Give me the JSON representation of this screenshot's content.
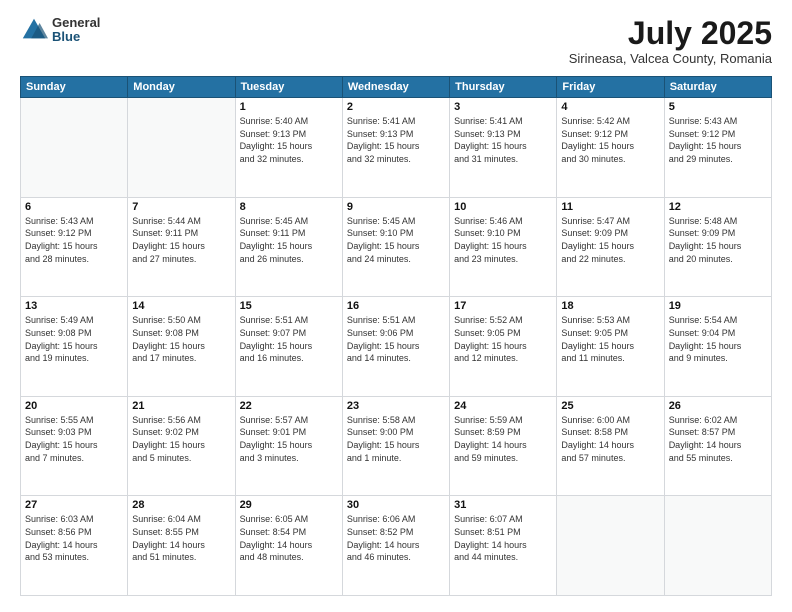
{
  "logo": {
    "general": "General",
    "blue": "Blue"
  },
  "title": "July 2025",
  "location": "Sirineasa, Valcea County, Romania",
  "days_of_week": [
    "Sunday",
    "Monday",
    "Tuesday",
    "Wednesday",
    "Thursday",
    "Friday",
    "Saturday"
  ],
  "weeks": [
    [
      {
        "day": "",
        "info": ""
      },
      {
        "day": "",
        "info": ""
      },
      {
        "day": "1",
        "info": "Sunrise: 5:40 AM\nSunset: 9:13 PM\nDaylight: 15 hours\nand 32 minutes."
      },
      {
        "day": "2",
        "info": "Sunrise: 5:41 AM\nSunset: 9:13 PM\nDaylight: 15 hours\nand 32 minutes."
      },
      {
        "day": "3",
        "info": "Sunrise: 5:41 AM\nSunset: 9:13 PM\nDaylight: 15 hours\nand 31 minutes."
      },
      {
        "day": "4",
        "info": "Sunrise: 5:42 AM\nSunset: 9:12 PM\nDaylight: 15 hours\nand 30 minutes."
      },
      {
        "day": "5",
        "info": "Sunrise: 5:43 AM\nSunset: 9:12 PM\nDaylight: 15 hours\nand 29 minutes."
      }
    ],
    [
      {
        "day": "6",
        "info": "Sunrise: 5:43 AM\nSunset: 9:12 PM\nDaylight: 15 hours\nand 28 minutes."
      },
      {
        "day": "7",
        "info": "Sunrise: 5:44 AM\nSunset: 9:11 PM\nDaylight: 15 hours\nand 27 minutes."
      },
      {
        "day": "8",
        "info": "Sunrise: 5:45 AM\nSunset: 9:11 PM\nDaylight: 15 hours\nand 26 minutes."
      },
      {
        "day": "9",
        "info": "Sunrise: 5:45 AM\nSunset: 9:10 PM\nDaylight: 15 hours\nand 24 minutes."
      },
      {
        "day": "10",
        "info": "Sunrise: 5:46 AM\nSunset: 9:10 PM\nDaylight: 15 hours\nand 23 minutes."
      },
      {
        "day": "11",
        "info": "Sunrise: 5:47 AM\nSunset: 9:09 PM\nDaylight: 15 hours\nand 22 minutes."
      },
      {
        "day": "12",
        "info": "Sunrise: 5:48 AM\nSunset: 9:09 PM\nDaylight: 15 hours\nand 20 minutes."
      }
    ],
    [
      {
        "day": "13",
        "info": "Sunrise: 5:49 AM\nSunset: 9:08 PM\nDaylight: 15 hours\nand 19 minutes."
      },
      {
        "day": "14",
        "info": "Sunrise: 5:50 AM\nSunset: 9:08 PM\nDaylight: 15 hours\nand 17 minutes."
      },
      {
        "day": "15",
        "info": "Sunrise: 5:51 AM\nSunset: 9:07 PM\nDaylight: 15 hours\nand 16 minutes."
      },
      {
        "day": "16",
        "info": "Sunrise: 5:51 AM\nSunset: 9:06 PM\nDaylight: 15 hours\nand 14 minutes."
      },
      {
        "day": "17",
        "info": "Sunrise: 5:52 AM\nSunset: 9:05 PM\nDaylight: 15 hours\nand 12 minutes."
      },
      {
        "day": "18",
        "info": "Sunrise: 5:53 AM\nSunset: 9:05 PM\nDaylight: 15 hours\nand 11 minutes."
      },
      {
        "day": "19",
        "info": "Sunrise: 5:54 AM\nSunset: 9:04 PM\nDaylight: 15 hours\nand 9 minutes."
      }
    ],
    [
      {
        "day": "20",
        "info": "Sunrise: 5:55 AM\nSunset: 9:03 PM\nDaylight: 15 hours\nand 7 minutes."
      },
      {
        "day": "21",
        "info": "Sunrise: 5:56 AM\nSunset: 9:02 PM\nDaylight: 15 hours\nand 5 minutes."
      },
      {
        "day": "22",
        "info": "Sunrise: 5:57 AM\nSunset: 9:01 PM\nDaylight: 15 hours\nand 3 minutes."
      },
      {
        "day": "23",
        "info": "Sunrise: 5:58 AM\nSunset: 9:00 PM\nDaylight: 15 hours\nand 1 minute."
      },
      {
        "day": "24",
        "info": "Sunrise: 5:59 AM\nSunset: 8:59 PM\nDaylight: 14 hours\nand 59 minutes."
      },
      {
        "day": "25",
        "info": "Sunrise: 6:00 AM\nSunset: 8:58 PM\nDaylight: 14 hours\nand 57 minutes."
      },
      {
        "day": "26",
        "info": "Sunrise: 6:02 AM\nSunset: 8:57 PM\nDaylight: 14 hours\nand 55 minutes."
      }
    ],
    [
      {
        "day": "27",
        "info": "Sunrise: 6:03 AM\nSunset: 8:56 PM\nDaylight: 14 hours\nand 53 minutes."
      },
      {
        "day": "28",
        "info": "Sunrise: 6:04 AM\nSunset: 8:55 PM\nDaylight: 14 hours\nand 51 minutes."
      },
      {
        "day": "29",
        "info": "Sunrise: 6:05 AM\nSunset: 8:54 PM\nDaylight: 14 hours\nand 48 minutes."
      },
      {
        "day": "30",
        "info": "Sunrise: 6:06 AM\nSunset: 8:52 PM\nDaylight: 14 hours\nand 46 minutes."
      },
      {
        "day": "31",
        "info": "Sunrise: 6:07 AM\nSunset: 8:51 PM\nDaylight: 14 hours\nand 44 minutes."
      },
      {
        "day": "",
        "info": ""
      },
      {
        "day": "",
        "info": ""
      }
    ]
  ]
}
